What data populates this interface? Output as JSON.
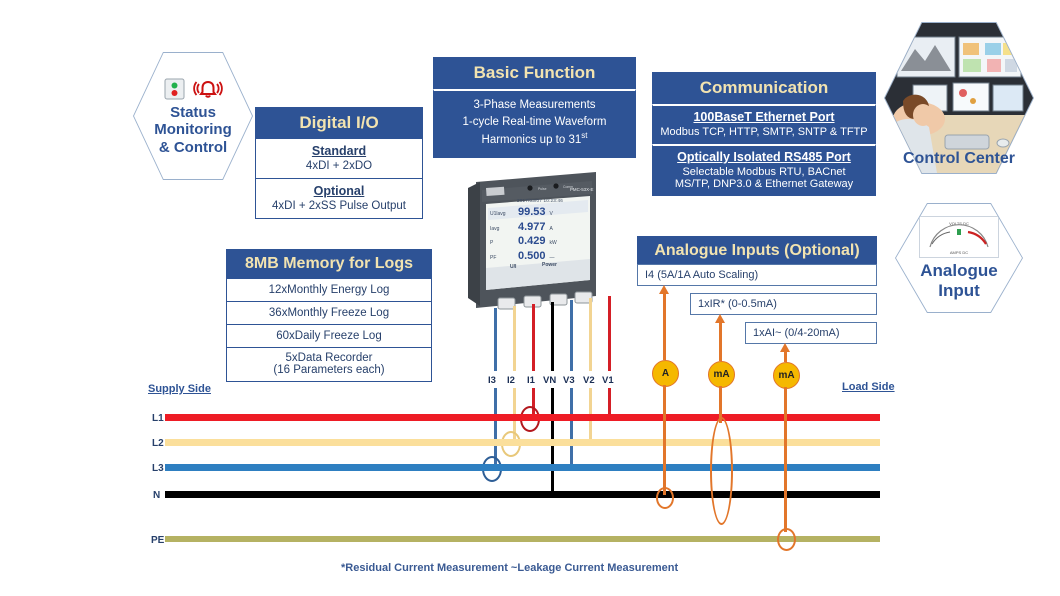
{
  "hexagons": {
    "status": {
      "line1": "Status",
      "line2": "Monitoring",
      "line3": "& Control",
      "icon": "alarm-bell-icon"
    },
    "control_center": {
      "label": "Control Center",
      "icon": "control-room-photo"
    },
    "analogue_input": {
      "line1": "Analogue",
      "line2": "Input",
      "icon": "analog-gauge-icon",
      "gauge_top": "VOLTS DC",
      "gauge_bottom": "AMPS DC"
    }
  },
  "panels": {
    "digital_io": {
      "title": "Digital I/O",
      "rows": [
        {
          "heading": "Standard",
          "detail": "4xDI + 2xDO"
        },
        {
          "heading": "Optional",
          "detail": "4xDI + 2xSS Pulse Output"
        }
      ]
    },
    "basic_function": {
      "title": "Basic Function",
      "lines": [
        "3-Phase Measurements",
        "1-cycle Real-time Waveform"
      ],
      "harmonics_text": "Harmonics up to 31",
      "harmonics_sup": "st"
    },
    "communication": {
      "title": "Communication",
      "rows": [
        {
          "heading": "100BaseT Ethernet Port",
          "details": [
            "Modbus TCP, HTTP, SMTP, SNTP & TFTP"
          ]
        },
        {
          "heading": "Optically Isolated RS485 Port",
          "details": [
            "Selectable Modbus RTU, BACnet",
            "MS/TP, DNP3.0 & Ethernet Gateway"
          ]
        }
      ]
    },
    "memory": {
      "title": "8MB Memory for Logs",
      "rows": [
        {
          "line1": "12xMonthly Energy Log"
        },
        {
          "line1": "36xMonthly Freeze Log"
        },
        {
          "line1": "60xDaily Freeze Log"
        },
        {
          "line1": "5xData Recorder",
          "line2": "(16 Parameters each)"
        }
      ]
    },
    "analogue_inputs": {
      "title": "Analogue Inputs (Optional)",
      "boxes": [
        {
          "label": "I4 (5A/1A Auto Scaling)"
        },
        {
          "label": "1xIR* (0-0.5mA)"
        },
        {
          "label": "1xAI~ (0/4-20mA)"
        }
      ]
    }
  },
  "meter": {
    "brand": "CET",
    "model": "PMC-53X-E",
    "led_left": "Pulse",
    "led_right": "Comm",
    "display": {
      "timestamp": "2017/03/07 10:23:46",
      "rows": [
        {
          "label": "U1lavg",
          "value": "99.53",
          "unit": "V"
        },
        {
          "label": "Iavg",
          "value": "4.977",
          "unit": "A"
        },
        {
          "label": "P",
          "value": "0.429",
          "unit": "kW"
        },
        {
          "label": "PF",
          "value": "0.500",
          "unit": "—"
        }
      ],
      "footer_left": "U/I",
      "footer_right": "Power"
    }
  },
  "wiring": {
    "supply_side_label": "Supply Side",
    "load_side_label": "Load Side",
    "terminals": [
      {
        "name": "I3",
        "color": "#3f6fa8"
      },
      {
        "name": "I2",
        "color": "#f2d492"
      },
      {
        "name": "I1",
        "color": "#d41f26"
      },
      {
        "name": "VN",
        "color": "#000000"
      },
      {
        "name": "V3",
        "color": "#3f6fa8"
      },
      {
        "name": "V2",
        "color": "#f2d492"
      },
      {
        "name": "V1",
        "color": "#d41f26"
      }
    ],
    "busbars": [
      {
        "name": "L1",
        "color": "#ee1c25"
      },
      {
        "name": "L2",
        "color": "#fbdf9b"
      },
      {
        "name": "L3",
        "color": "#2e7fc1"
      },
      {
        "name": "N",
        "color": "#000000"
      },
      {
        "name": "PE",
        "color": "#b5b263"
      }
    ],
    "analogue_markers": [
      {
        "label": "A"
      },
      {
        "label": "mA"
      },
      {
        "label": "mA"
      }
    ]
  },
  "footnote": "*Residual Current Measurement  ~Leakage Current Measurement",
  "colors": {
    "panel_blue": "#2e5395",
    "panel_title_gold": "#f2e3b0",
    "text_blue": "#27406b",
    "orange": "#e2762a",
    "gold": "#f5b800"
  }
}
